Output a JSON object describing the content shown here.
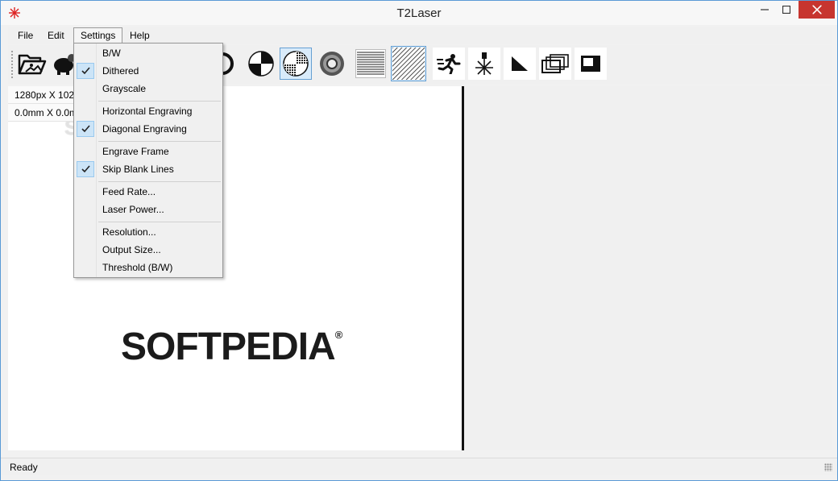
{
  "window": {
    "title": "T2Laser"
  },
  "menubar": {
    "file": "File",
    "edit": "Edit",
    "settings": "Settings",
    "help": "Help"
  },
  "info": {
    "pixels": "1280px X 1024",
    "mm": "0.0mm X 0.0m"
  },
  "canvas": {
    "logo_text": "SOFTPEDIA",
    "logo_reg": "®",
    "watermark": "SOFTPEDIA"
  },
  "status": {
    "text": "Ready"
  },
  "settings_menu": {
    "bw": "B/W",
    "dithered": "Dithered",
    "grayscale": "Grayscale",
    "horizontal": "Horizontal Engraving",
    "diagonal": "Diagonal Engraving",
    "engrave_frame": "Engrave Frame",
    "skip_blank": "Skip Blank Lines",
    "feed_rate": "Feed Rate...",
    "laser_power": "Laser Power...",
    "resolution": "Resolution...",
    "output_size": "Output Size...",
    "threshold": "Threshold (B/W)"
  },
  "checked": {
    "dithered": true,
    "diagonal": true,
    "skip_blank": true
  },
  "colors": {
    "accent": "#66a0d3",
    "close": "#c7352f",
    "check_bg": "#cce4f7"
  },
  "icons": [
    "app-logo-icon",
    "open-image-icon",
    "piggy-icon",
    "bw-mode-icon",
    "dithered-mode-icon",
    "grayscale-mode-icon",
    "horizontal-lines-icon",
    "diagonal-lines-icon",
    "run-icon",
    "laser-icon",
    "triangle-icon",
    "frame-icon",
    "output-icon"
  ]
}
